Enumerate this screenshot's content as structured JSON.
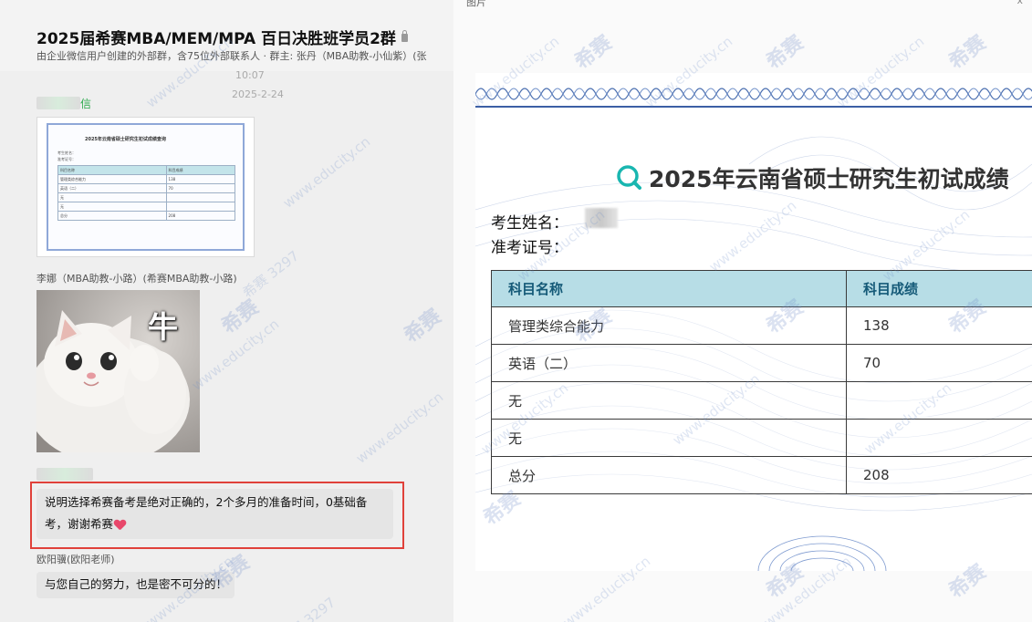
{
  "chat": {
    "title": "2025届希赛MBA/MEM/MPA 百日决胜班学员2群",
    "subtitle": "由企业微信用户创建的外部群，含75位外部联系人 · 群主: 张丹（MBA助教-小仙紫）(张",
    "timestamp_1": "10:07",
    "timestamp_2": "2025-2-24",
    "sender_1_suffix": "信",
    "sender_2": "李娜（MBA助教-小路）(希赛MBA助教-小路)",
    "sticker_text": "牛",
    "message_1": "说明选择希赛备考是绝对正确的，2个多月的准备时间，0基础备考，谢谢希赛",
    "sender_4": "欧阳骥(欧阳老师)",
    "message_2": "与您自己的努力，也是密不可分的！",
    "thumbnail": {
      "title": "2025年云南省硕士研究生初试成绩查询",
      "name_label": "考生姓名：",
      "id_label": "准考证号：",
      "rows": [
        [
          "科目名称",
          "科目成绩"
        ],
        [
          "管理类综合能力",
          "138"
        ],
        [
          "英语（二）",
          "70"
        ],
        [
          "无",
          ""
        ],
        [
          "无",
          ""
        ],
        [
          "总分",
          "208"
        ]
      ]
    }
  },
  "viewer": {
    "tab_label": "图片",
    "close_label": "x"
  },
  "certificate": {
    "title": "2025年云南省硕士研究生初试成绩",
    "name_label": "考生姓名：",
    "id_label": "准考证号：",
    "header": [
      "科目名称",
      "科目成绩"
    ],
    "rows": [
      [
        "管理类综合能力",
        "138"
      ],
      [
        "英语（二）",
        "70"
      ],
      [
        "无",
        ""
      ],
      [
        "无",
        ""
      ],
      [
        "总分",
        "208"
      ]
    ]
  },
  "watermark": {
    "site": "www.educity.cn",
    "brand": "希赛",
    "qq": "希赛 3297"
  },
  "colors": {
    "highlight_border": "#e0413a",
    "table_header_bg": "#b7dde6",
    "table_header_text": "#155a78",
    "sender_green": "#2aa84a",
    "heart": "#e8476a"
  },
  "icons": [
    "lock-icon",
    "heart-icon",
    "search-logo-icon"
  ]
}
